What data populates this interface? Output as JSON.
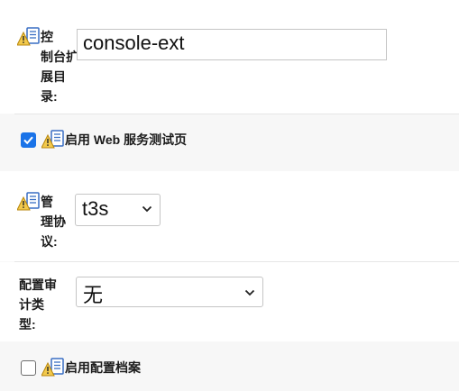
{
  "fields": {
    "console_ext_dir": {
      "label": "控\n制台扩\n展目\n录:",
      "value": "console-ext"
    },
    "web_service_test_page": {
      "label": "启用 Web 服务测试页",
      "checked": true
    },
    "admin_protocol": {
      "label": "管\n理协\n议:",
      "value": "t3s"
    },
    "config_audit_type": {
      "label": "配置审\n计类\n型:",
      "value": "无"
    },
    "config_archive": {
      "label": "启用配置档案",
      "checked": false
    }
  },
  "icons": {
    "warning_doc": "warning-document-icon",
    "chevron": "chevron-down-icon",
    "check": "checkmark-icon"
  },
  "colors": {
    "checkbox_on": "#1a73e8",
    "warning_yellow": "#f2c94c",
    "doc_blue": "#3a6fc4"
  }
}
